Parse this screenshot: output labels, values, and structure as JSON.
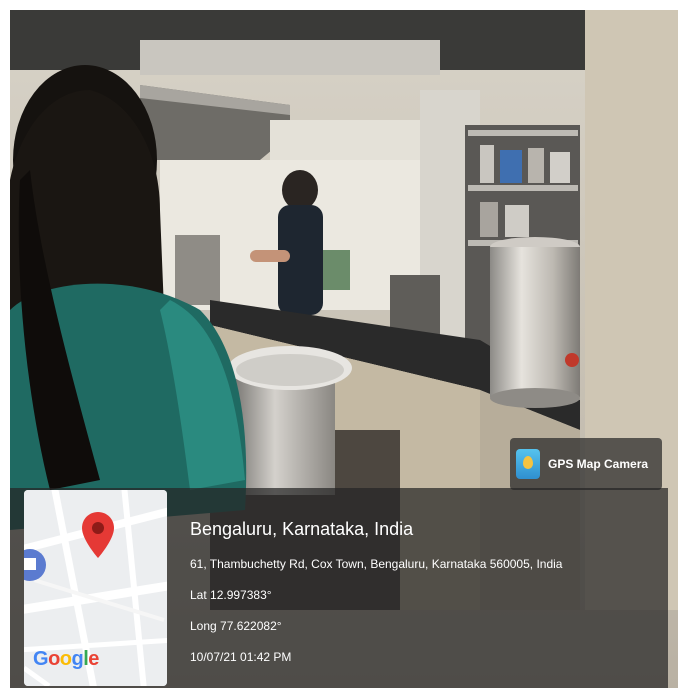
{
  "app_badge": {
    "label": "GPS Map Camera",
    "icon": "gps-map-camera-app-icon"
  },
  "location": {
    "place": "Bengaluru, Karnataka, India",
    "address": "61, Thambuchetty Rd, Cox Town, Bengaluru, Karnataka 560005, India",
    "latitude": "Lat 12.997383°",
    "longitude": "Long 77.622082°",
    "datetime": "10/07/21 01:42 PM"
  },
  "map_thumbnail": {
    "logo_text": "Google",
    "marker_icon": "map-pin-icon",
    "marker_color": "#e53935"
  },
  "colors": {
    "overlay": "#262626",
    "text": "#ffffff"
  }
}
